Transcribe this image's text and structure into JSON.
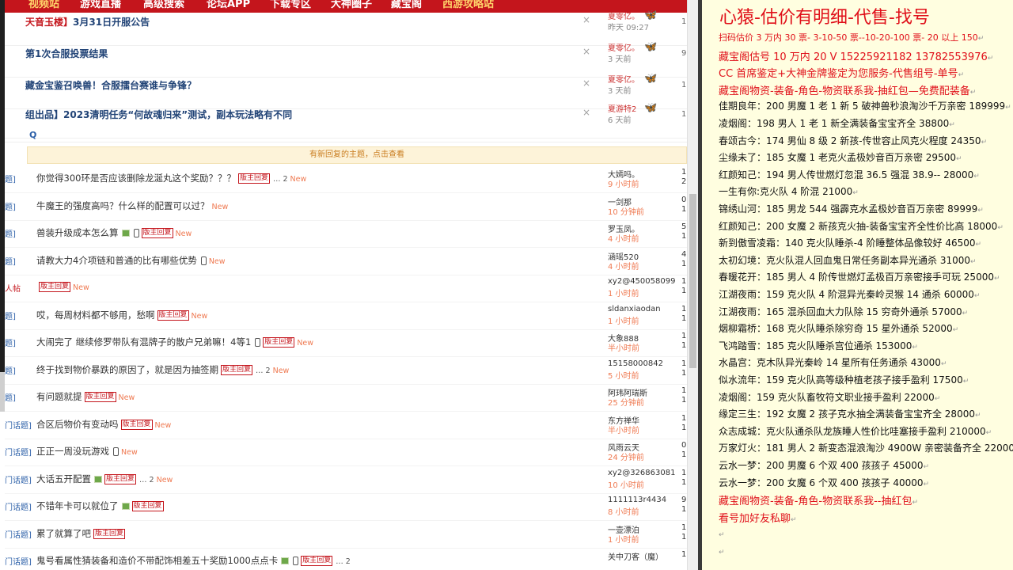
{
  "nav": {
    "items": [
      "视频站",
      "游戏直播",
      "高级搜索",
      "论坛APP",
      "下载专区",
      "大神圈子",
      "藏宝阁",
      "西游攻略站"
    ],
    "highlight_color": "#ffd36a",
    "bg_color": "#c4151c"
  },
  "announcements": [
    {
      "title_prefix": "天音玉楼】",
      "title": "3月31日开服公告",
      "author": "夏零亿。",
      "time": "昨天 09:27",
      "num": "1"
    },
    {
      "title_prefix": "",
      "title": "第1次合服投票结果",
      "author": "夏零亿。",
      "time": "3 天前",
      "num": "9"
    },
    {
      "title_prefix": "",
      "title": "藏金宝鉴召唤兽！合服擂台赛谁与争锋？",
      "author": "夏零亿。",
      "time": "3 天前",
      "num": "1"
    },
    {
      "title_prefix": "",
      "title": "组出品】2023清明任务“何故魂归来”测试，副本玩法略有不同",
      "author": "夏游特2",
      "time": "6 天前",
      "num": "1"
    }
  ],
  "close_glyph": "×",
  "search_glyph": "Q",
  "notice_text": "有新回复的主题，点击查看",
  "threads": [
    {
      "prefix": "题]",
      "title": "你觉得300环是否应该删除龙涎丸这个奖励？？？",
      "tag": "版主回复",
      "pages": "… 2",
      "new": "New",
      "author": "大嫣吗。",
      "time": "9 小时前",
      "n1": "1",
      "n2": "2"
    },
    {
      "prefix": "题]",
      "title": "牛魔王的强度高吗？什么样的配置可以过？",
      "tag": "",
      "pages": "",
      "new": "New",
      "author": "一剑那",
      "time": "10 分钟前",
      "n1": "0",
      "n2": "1"
    },
    {
      "prefix": "题]",
      "title": "兽装升级成本怎么算",
      "tag": "版主回复",
      "pages": "",
      "new": "New",
      "author": "罗玉凤。",
      "time": "4 小时前",
      "n1": "5",
      "n2": "1"
    },
    {
      "prefix": "题]",
      "title": "请教大力4介项链和普通的比有哪些优势",
      "tag": "",
      "pages": "",
      "new": "New",
      "author": "涵瑶520",
      "time": "4 小时前",
      "n1": "4",
      "n2": "1"
    },
    {
      "prefix": "人帖",
      "title": "",
      "tag": "版主回复",
      "pages": "",
      "new": "New",
      "author": "xy2@450058099",
      "time": "1 小时前",
      "n1": "1",
      "n2": "1"
    },
    {
      "prefix": "题]",
      "title": "哎，每周材料都不够用，愁啊",
      "tag": "版主回复",
      "pages": "",
      "new": "New",
      "author": "sldanxiaodan",
      "time": "1 小时前",
      "n1": "1",
      "n2": "1"
    },
    {
      "prefix": "题]",
      "title": "大闹完了 继续修罗带队有混牌子的散户兄弟嘛！4等1",
      "tag": "版主回复",
      "pages": "",
      "new": "New",
      "author": "大象888",
      "time": "半小时前",
      "n1": "1",
      "n2": "1"
    },
    {
      "prefix": "题]",
      "title": "终于找到物价暴跌的原因了，就是因为抽签期",
      "tag": "版主回复",
      "pages": "… 2",
      "new": "New",
      "author": "15158000842",
      "time": "5 小时前",
      "n1": "1",
      "n2": "1"
    },
    {
      "prefix": "题]",
      "title": "有问题就提",
      "tag": "版主回复",
      "pages": "",
      "new": "New",
      "author": "阿玮阿瑞斯",
      "time": "25 分钟前",
      "n1": "1",
      "n2": "1"
    },
    {
      "prefix": "门话题]",
      "title": "合区后物价有变动吗",
      "tag": "版主回复",
      "pages": "",
      "new": "New",
      "author": "东方禅华",
      "time": "半小时前",
      "n1": "1",
      "n2": "1"
    },
    {
      "prefix": "门话题]",
      "title": "正正一周没玩游戏",
      "tag": "",
      "pages": "",
      "new": "New",
      "author": "风雨云天",
      "time": "24 分钟前",
      "n1": "0",
      "n2": "1"
    },
    {
      "prefix": "门话题]",
      "title": "大话五开配置",
      "tag": "版主回复",
      "pages": "… 2",
      "new": "New",
      "author": "xy2@326863081",
      "time": "10 小时前",
      "n1": "1",
      "n2": "1"
    },
    {
      "prefix": "门话题]",
      "title": "不错年卡可以就位了",
      "tag": "版主回复",
      "pages": "",
      "new": "",
      "author": "1111113r4434",
      "time": "8 小时前",
      "n1": "9",
      "n2": "1"
    },
    {
      "prefix": "门话题]",
      "title": "累了就算了吧",
      "tag": "版主回复",
      "pages": "",
      "new": "",
      "author": "一壶漂泊",
      "time": "1 小时前",
      "n1": "1",
      "n2": "1"
    },
    {
      "prefix": "门话题]",
      "title": "鬼号看属性猜装备和造价不带配饰相差五十奖励1000点点卡",
      "tag": "版主回复",
      "pages": "… 2",
      "new": "",
      "author": "关中刀客（魔）",
      "time": "",
      "n1": "1",
      "n2": ""
    }
  ],
  "notepad": {
    "title": "心猿-估价有明细-代售-找号",
    "lines": [
      {
        "text": "扫码估价 3 万内 30 票- 3-10-50 票--10-20-100 票- 20 以上 150",
        "style": "red small"
      },
      {
        "text": "藏宝阁估号 10 万内 20 V 15225921182   13782553976",
        "style": "red"
      },
      {
        "text": "CC 首席鉴定+大神金牌鉴定为您服务-代售组号-单号",
        "style": "red"
      },
      {
        "text": "藏宝阁物资-装备-角色-物资联系我-抽红包—免费配装备",
        "style": "red"
      },
      {
        "text": "佳期良年：200 男魔 1 老 1 新 5 破神兽秒浪淘沙千万亲密 189999",
        "style": ""
      },
      {
        "text": "凌烟阁：198 男人 1 老 1 新全满装备宝宝齐全 38800",
        "style": ""
      },
      {
        "text": "春颂古今：174 男仙 8 级 2 新孩-传世容止风克火程度 24350",
        "style": ""
      },
      {
        "text": "尘缘未了：185 女魔 1 老克火孟极妙音百万亲密 29500",
        "style": ""
      },
      {
        "text": "红颜知己：194 男人传世燃灯忽混 36.5 强混 38.9-- 28000",
        "style": ""
      },
      {
        "text": "一生有你:克火队 4 阶混 21000",
        "style": ""
      },
      {
        "text": "锦绣山河：185 男龙 544 强霹克水孟极妙音百万亲密 89999",
        "style": ""
      },
      {
        "text": "红颜知己：200 女魔 2 新孩克火抽-装备宝宝齐全性价比高 18000",
        "style": ""
      },
      {
        "text": "新到傲雪凌霜：140 克火队睡杀-4 阶睡整体品像较好 46500",
        "style": ""
      },
      {
        "text": "太初幻境：克火队混人回血鬼日常任务副本异光通杀 31000",
        "style": ""
      },
      {
        "text": "春暖花开：185 男人 4 阶传世燃灯孟极百万亲密接手可玩 25000",
        "style": ""
      },
      {
        "text": "江湖夜雨：159 克火队 4 阶混异光秦岭灵猴 14 通杀 60000",
        "style": ""
      },
      {
        "text": "江湖夜雨：165 混杀回血大力队除 15 穷奇外通杀 57000",
        "style": ""
      },
      {
        "text": "烟柳霜桥：168 克火队睡杀除穷奇 15 星外通杀 52000",
        "style": ""
      },
      {
        "text": "飞鸿踏雪：185 克火队睡杀宫位通杀 153000",
        "style": ""
      },
      {
        "text": "水晶宫：克木队异光秦岭 14 星所有任务通杀 43000",
        "style": ""
      },
      {
        "text": "似水流年：159 克火队高等级种植老孩子接手盈利 17500",
        "style": ""
      },
      {
        "text": "凌烟阁：159 克火队畜牧符文职业接手盈利 22000",
        "style": ""
      },
      {
        "text": "缘定三生：192 女魔 2 孩子克水抽全满装备宝宝齐全 28000",
        "style": ""
      },
      {
        "text": "众志成城：克火队通杀队龙族睡人性价比哇塞接手盈利 210000",
        "style": ""
      },
      {
        "text": "万家灯火：181 男人 2 新变态混浪淘沙 4900W 亲密装备齐全 220000",
        "style": ""
      },
      {
        "text": "云水一梦：200 男魔 6 个双 400 孩孩子 45000",
        "style": ""
      },
      {
        "text": "云水一梦：200 女魔 6 个双 400 孩孩子 40000",
        "style": ""
      },
      {
        "text": "藏宝阁物资-装备-角色-物资联系我--抽红包",
        "style": "red"
      },
      {
        "text": "看号加好友私聊",
        "style": "red"
      }
    ],
    "return_glyph": "↵"
  },
  "colors": {
    "accent_red": "#e0101a",
    "forum_blue": "#224477",
    "new_orange": "#ef7a52",
    "notepad_bg": "#fffee0"
  }
}
